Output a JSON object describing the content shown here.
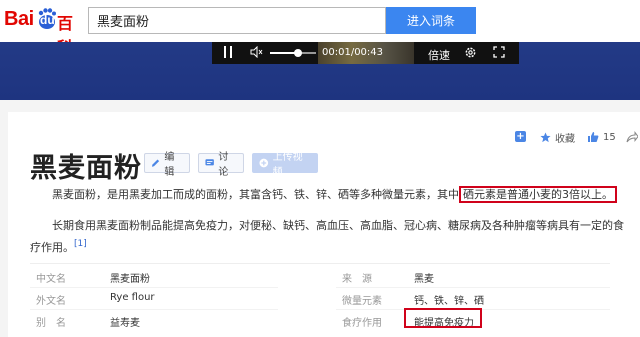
{
  "header": {
    "logo_bai": "Bai",
    "logo_du": "du",
    "logo_baike": "百科",
    "search_value": "黑麦面粉",
    "search_button": "进入词条"
  },
  "video": {
    "time": "00:01/00:43",
    "speed_label": "倍速",
    "volume_level": 0.6
  },
  "entry": {
    "title": "黑麦面粉",
    "edit_label": "编辑",
    "discuss_label": "讨论",
    "upload_video_label": "上传视频",
    "favorite_label": "收藏",
    "like_count": "15"
  },
  "body": {
    "p1_text": "黑麦面粉，是用黑麦加工而成的面粉，其富含钙、铁、锌、硒等多种微量元素，其中",
    "p1_highlight": "硒元素是普通小麦的3倍以上。",
    "p2_text": "长期食用黑麦面粉制品能提高免疫力，对便秘、缺钙、高血压、高血脂、冠心病、糖尿病及各种肿瘤等病具有一定的食疗作用。",
    "p2_cite": "[1]"
  },
  "info": {
    "rows": [
      {
        "k1": "中文名",
        "v1": "黑麦面粉",
        "k2": "来　源",
        "v2": "黑麦"
      },
      {
        "k1": "外文名",
        "v1": "Rye flour",
        "k2": "微量元素",
        "v2": "钙、铁、锌、硒"
      },
      {
        "k1": "别　名",
        "v1": "益寿麦",
        "k2": "食疗作用",
        "v2": "能提高免疫力"
      }
    ]
  },
  "colors": {
    "brand_red": "#e10602",
    "brand_blue": "#3b86f0",
    "banner_blue": "#233a86",
    "highlight_red": "#d0021b"
  }
}
